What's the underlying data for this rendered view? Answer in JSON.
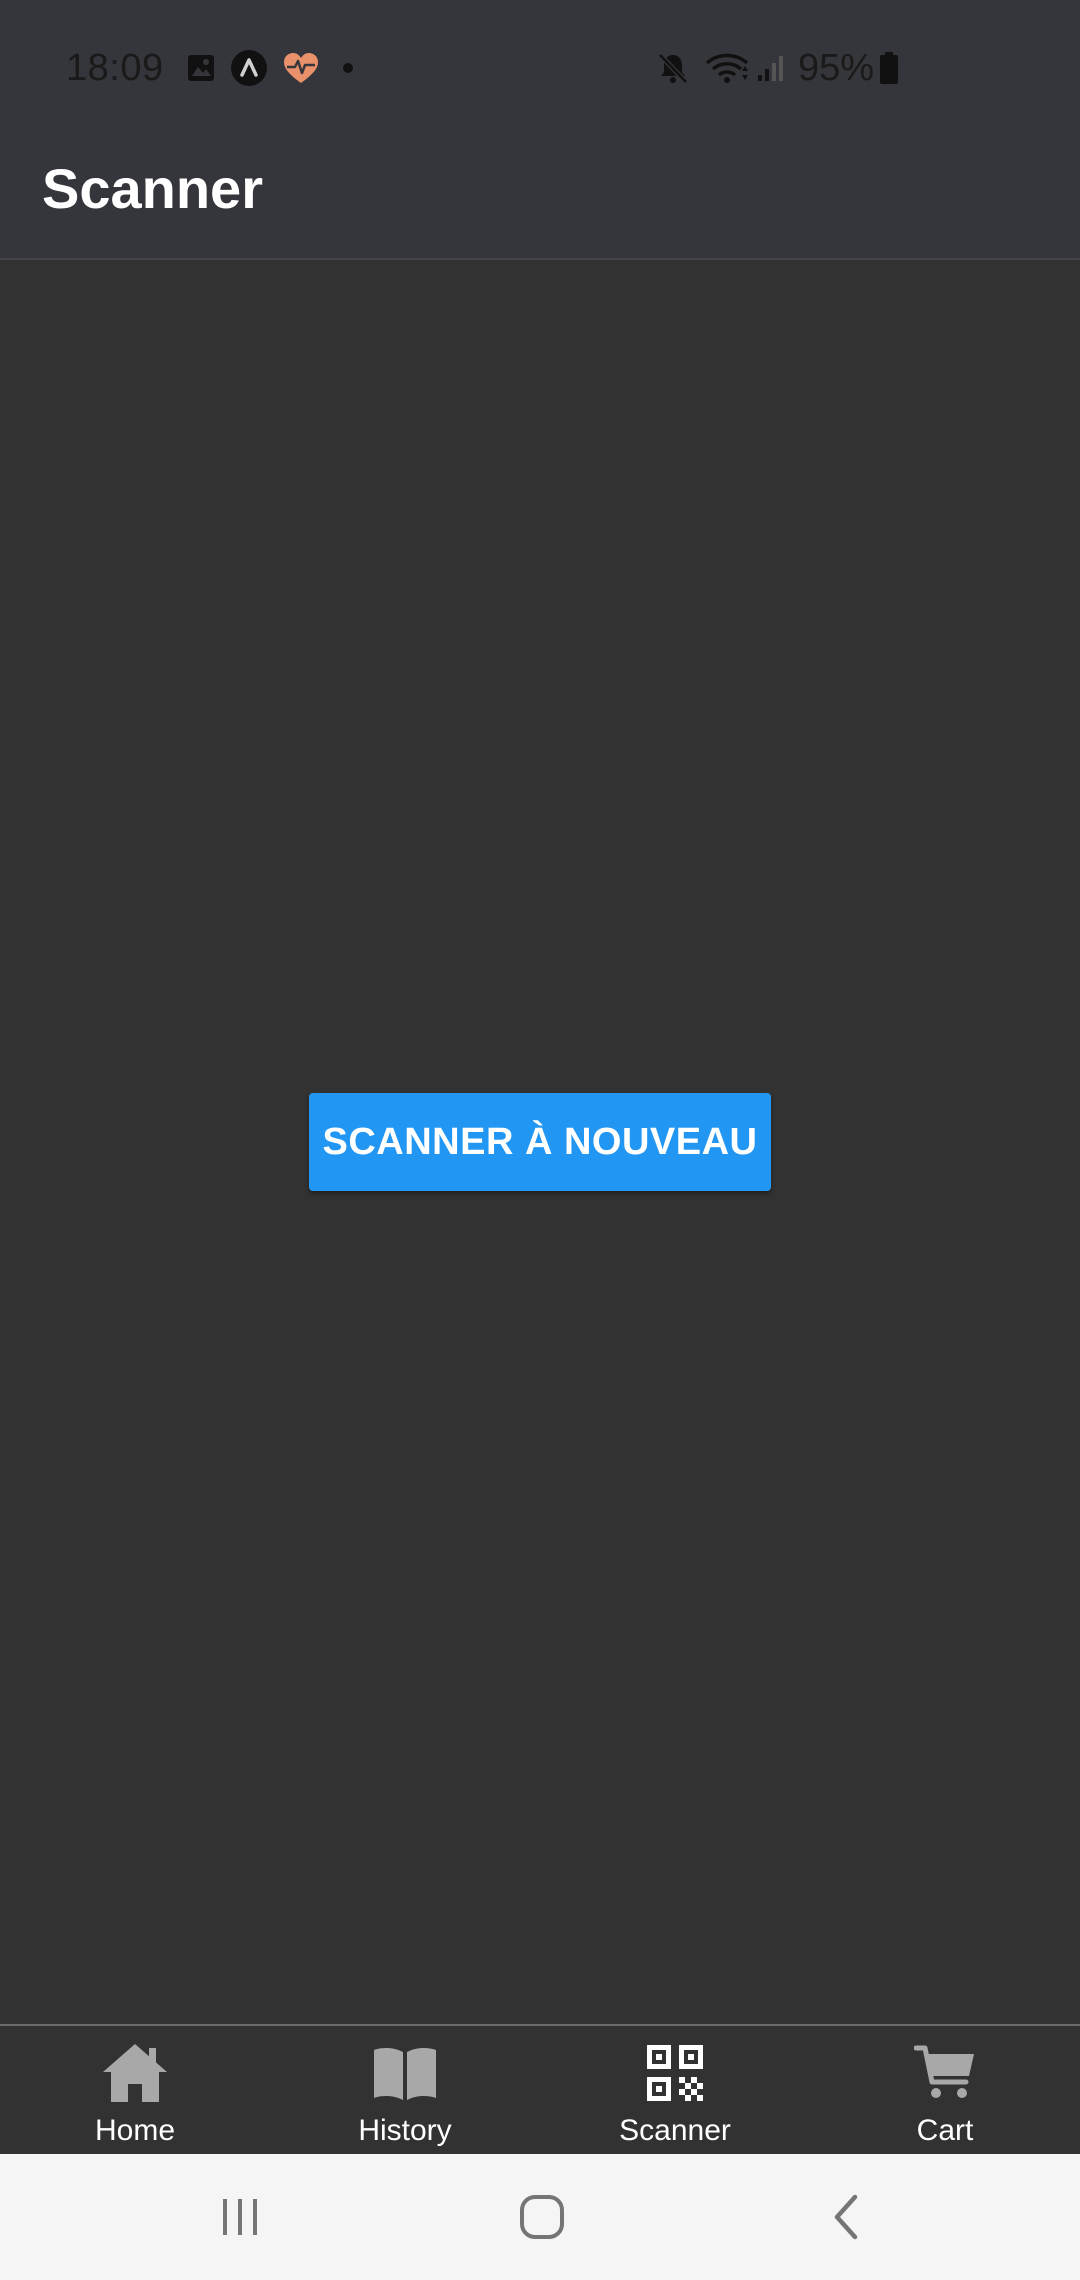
{
  "status_bar": {
    "time": "18:09",
    "battery": "95%",
    "icons_left": [
      "gallery-icon",
      "app-a-icon",
      "health-heart-icon",
      "notification-dot-icon"
    ],
    "icons_right": [
      "mute-icon",
      "wifi-icon",
      "signal-icon",
      "battery-icon"
    ]
  },
  "app_bar": {
    "title": "Scanner"
  },
  "main": {
    "rescan_button_label": "SCANNER À NOUVEAU"
  },
  "tab_bar": {
    "tabs": [
      {
        "label": "Home",
        "icon": "home-icon"
      },
      {
        "label": "History",
        "icon": "book-icon"
      },
      {
        "label": "Scanner",
        "icon": "qr-code-icon",
        "active": true
      },
      {
        "label": "Cart",
        "icon": "cart-icon"
      }
    ]
  },
  "nav_bar": {
    "buttons": [
      "recents-icon",
      "home-circle-icon",
      "back-icon"
    ]
  },
  "colors": {
    "accent": "#2196f3",
    "background": "#323232",
    "app_bar": "#35363b",
    "tab_icon_inactive": "#a8a8a8",
    "tab_icon_active": "#ffffff"
  }
}
